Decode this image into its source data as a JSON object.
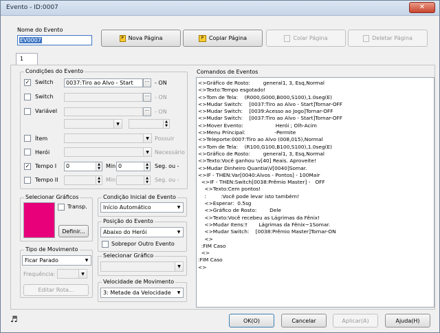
{
  "window": {
    "title": "Evento - ID:0007",
    "close": "✕"
  },
  "event_name": {
    "label": "Nome do Evento",
    "value": "EV0007"
  },
  "toolbar": {
    "new_page": "Nova Página",
    "copy_page": "Copiar Página",
    "paste_page": "Colar Página",
    "delete_page": "Deletar Página"
  },
  "tabs": [
    "1"
  ],
  "conditions": {
    "label": "Condições do Evento",
    "switch1": {
      "label": "Switch",
      "checked": true,
      "value": "0037:Tiro ao Alvo - Start",
      "suffix": "- ON"
    },
    "switch2": {
      "label": "Switch",
      "checked": false,
      "value": "",
      "suffix": "- ON"
    },
    "variable": {
      "label": "Variável",
      "checked": false,
      "value": "",
      "suffix": "- ON"
    },
    "item": {
      "label": "Ítem",
      "checked": false,
      "suffix": "Possuir"
    },
    "hero": {
      "label": "Herói",
      "checked": false,
      "suffix": "Necessário"
    },
    "timer1": {
      "label": "Tempo I",
      "checked": true,
      "value": "0",
      "min_label": "Min",
      "sec_value": "0",
      "suffix": "Seg. ou -"
    },
    "timer2": {
      "label": "Tempo II",
      "checked": false,
      "value": "",
      "min_label": "Min",
      "sec_value": "",
      "suffix": "Seg. ou -"
    }
  },
  "graphics": {
    "label": "Selecionar Gráficos",
    "transp_label": "Transp.",
    "define_label": "Definir..."
  },
  "start_condition": {
    "label": "Condição Inicial de Evento",
    "value": "Início Automático"
  },
  "event_position": {
    "label": "Posição do Evento",
    "value": "Abaixo do Herói",
    "overlap_label": "Sobrepor Outro Evento"
  },
  "movement_type": {
    "label": "Tipo de Movimento",
    "value": "Ficar Parado",
    "frequency_label": "Frequência:",
    "edit_route": "Editar Rota..."
  },
  "select_graphic": {
    "label": "Selecionar Gráfico",
    "value": ""
  },
  "movement_speed": {
    "label": "Velocidade de Movimento",
    "value": "3: Metade da Velocidade"
  },
  "commands": {
    "label": "Comandos de Eventos",
    "lines": [
      "<>Gráfico de Rosto:        general1, 3, Esq,Normal",
      "<>Texto:Tempo esgotado!",
      "<>Tom de Tela:    (R000,G000,B000,S100),1.0seg(E)",
      "<>Mudar Switch:    [0037:Tiro ao Alvo - Start]Tornar-OFF",
      "<>Mudar Switch:    [0039:Acesso ao Jogo]Tornar-OFF",
      "<>Mudar Switch:    [0037:Tiro ao Alvo - Start]Tornar-OFF",
      "<>Mover Evento:                    Herói ; Olh-Acim",
      "<>Menu Principal:                  -Permite",
      "<>Teleporte:0007:Tiro ao Alvo (008,015),Normal",
      "<>Tom de Tela:    (R100,G100,B100,S100),1.0seg(E)",
      "<>Gráfico de Rosto:        general1, 3, Esq,Normal",
      "<>Texto:Você ganhou \\v[40] Reais. Aproveite!",
      "<>Mudar Dinheiro Quantia\\V[0040]Somar.",
      "<>IF - THEN:Var[0040:Alvos - Pontos] - 100Mair",
      "  <>IF - THEN:Switch[0038:Prêmio Master] -   OFF",
      "    <>Texto:Cem pontos!",
      "    :         :Você pode levar isto também!",
      "    <>Esperar:  0.5sg",
      "    <>Gráfico de Rosto:        Dele",
      "    <>Texto:Você recebeu as Lágrimas da Fênix!",
      "    <>Mudar Itens:†       Lágrimas da Fênix~1Somar.",
      "    <>Mudar Switch:    [0038:Prêmio Master]Tornar-ON",
      "    <>",
      "  :FIM Caso",
      "  <>",
      ":FIM Caso",
      "<>"
    ]
  },
  "footer": {
    "ok": "OK(O)",
    "cancel": "Cancelar",
    "apply": "Aplicar(A)",
    "help": "Ajuda(H)"
  },
  "colors": {
    "graphic_preview": "#e8007a",
    "selection": "#3b74c4"
  }
}
